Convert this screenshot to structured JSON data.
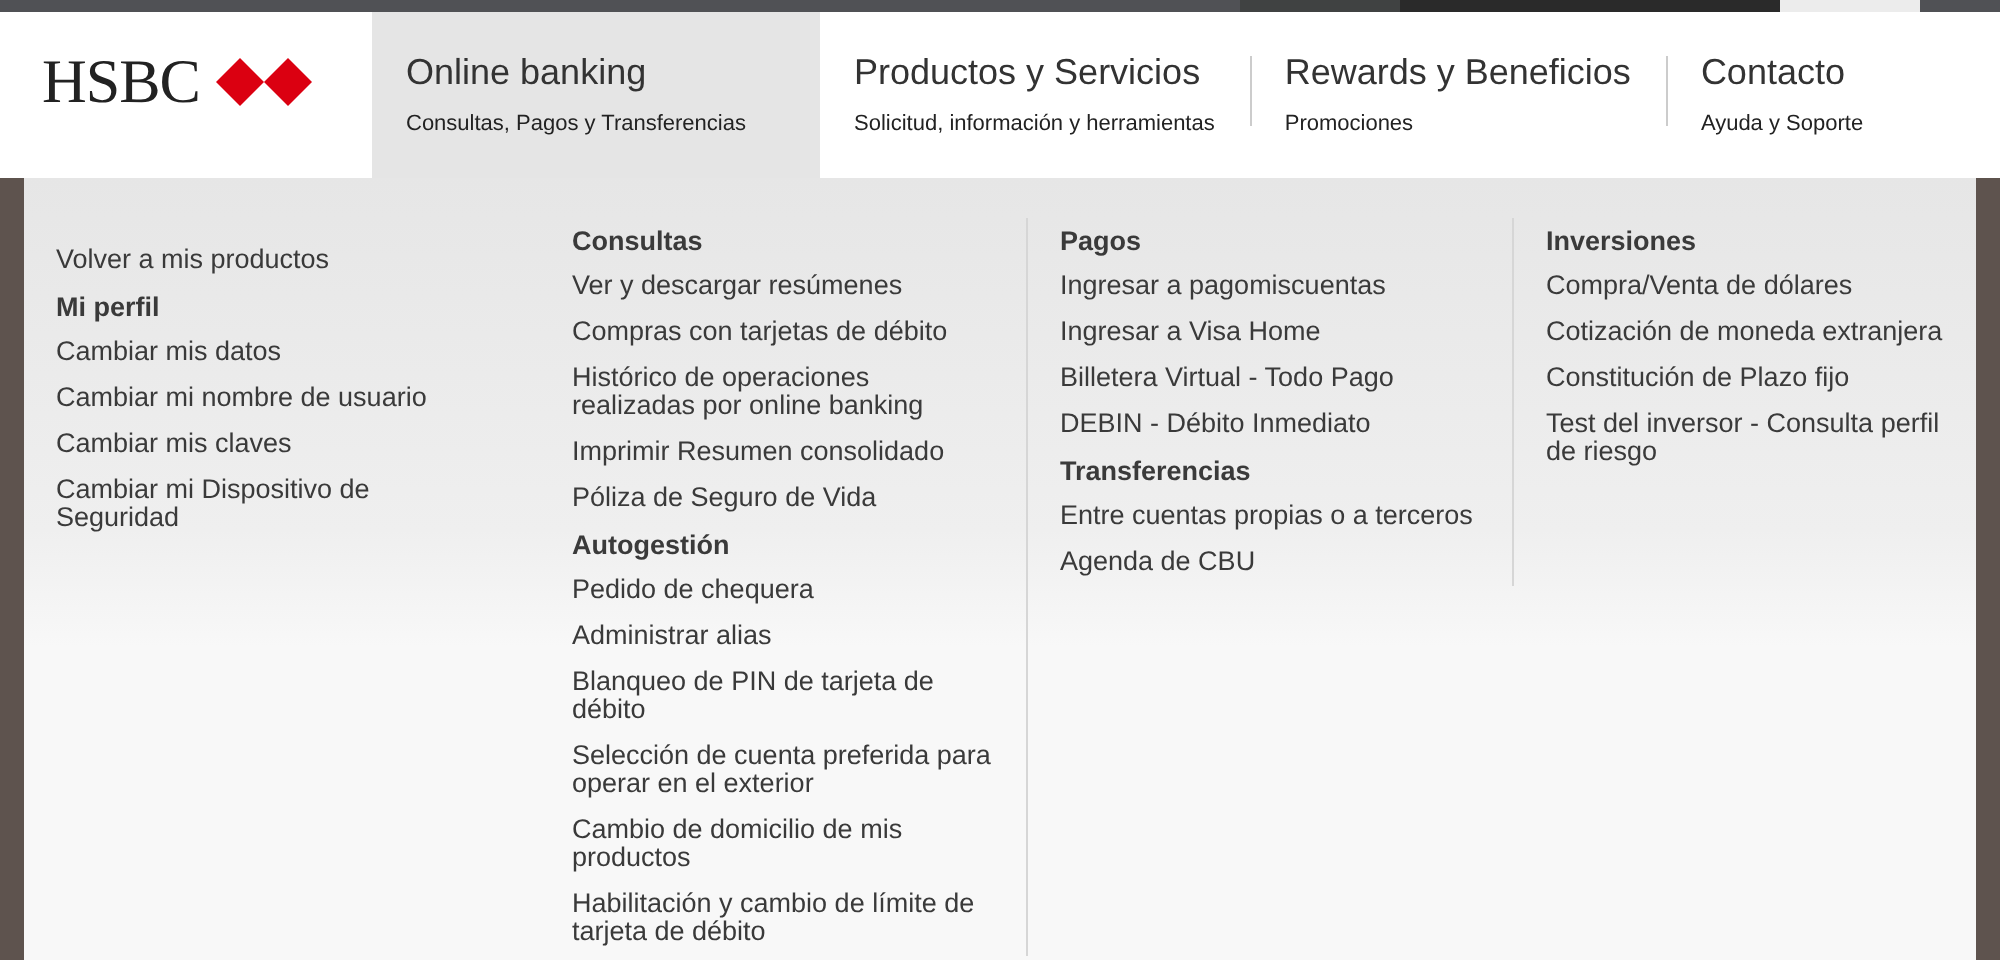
{
  "logo": {
    "text": "HSBC"
  },
  "nav": [
    {
      "title": "Online banking",
      "subtitle": "Consultas, Pagos y Transferencias",
      "selected": true
    },
    {
      "title": "Productos y Servicios",
      "subtitle": "Solicitud, información y herramientas",
      "selected": false
    },
    {
      "title": "Rewards y Beneficios",
      "subtitle": "Promociones",
      "selected": false
    },
    {
      "title": "Contacto",
      "subtitle": "Ayuda y Soporte",
      "selected": false
    }
  ],
  "menu_columns": [
    {
      "items": [
        {
          "kind": "link",
          "text": "Volver a mis productos"
        },
        {
          "kind": "heading",
          "text": "Mi perfil"
        },
        {
          "kind": "link",
          "text": "Cambiar mis datos"
        },
        {
          "kind": "link",
          "text": "Cambiar mi nombre de usuario"
        },
        {
          "kind": "link",
          "text": "Cambiar mis claves"
        },
        {
          "kind": "link",
          "text": "Cambiar mi Dispositivo de Seguridad"
        }
      ]
    },
    {
      "items": [
        {
          "kind": "heading",
          "text": "Consultas"
        },
        {
          "kind": "link",
          "text": "Ver y descargar resúmenes"
        },
        {
          "kind": "link",
          "text": "Compras con tarjetas de débito"
        },
        {
          "kind": "link",
          "text": "Histórico de operaciones realizadas por online banking"
        },
        {
          "kind": "link",
          "text": "Imprimir Resumen consolidado"
        },
        {
          "kind": "link",
          "text": "Póliza de Seguro de Vida"
        },
        {
          "kind": "heading",
          "text": "Autogestión"
        },
        {
          "kind": "link",
          "text": "Pedido de chequera"
        },
        {
          "kind": "link",
          "text": "Administrar alias"
        },
        {
          "kind": "link",
          "text": "Blanqueo de PIN de tarjeta de débito"
        },
        {
          "kind": "link",
          "text": "Selección de cuenta preferida para operar en el exterior"
        },
        {
          "kind": "link",
          "text": "Cambio de domicilio de mis productos"
        },
        {
          "kind": "link",
          "text": "Habilitación y cambio de límite de tarjeta de débito"
        }
      ]
    },
    {
      "items": [
        {
          "kind": "heading",
          "text": "Pagos"
        },
        {
          "kind": "link",
          "text": "Ingresar a pagomiscuentas"
        },
        {
          "kind": "link",
          "text": "Ingresar a Visa Home"
        },
        {
          "kind": "link",
          "text": "Billetera Virtual - Todo Pago"
        },
        {
          "kind": "link",
          "text": "DEBIN - Débito Inmediato"
        },
        {
          "kind": "heading",
          "text": "Transferencias"
        },
        {
          "kind": "link",
          "text": "Entre cuentas propias o a terceros"
        },
        {
          "kind": "link",
          "text": "Agenda de CBU"
        }
      ]
    },
    {
      "items": [
        {
          "kind": "heading",
          "text": "Inversiones"
        },
        {
          "kind": "link",
          "text": "Compra/Venta de dólares"
        },
        {
          "kind": "link",
          "text": "Cotización de moneda extranjera"
        },
        {
          "kind": "link",
          "text": "Constitución de Plazo fijo"
        },
        {
          "kind": "link",
          "text": "Test del inversor - Consulta perfil de riesgo"
        }
      ]
    }
  ]
}
